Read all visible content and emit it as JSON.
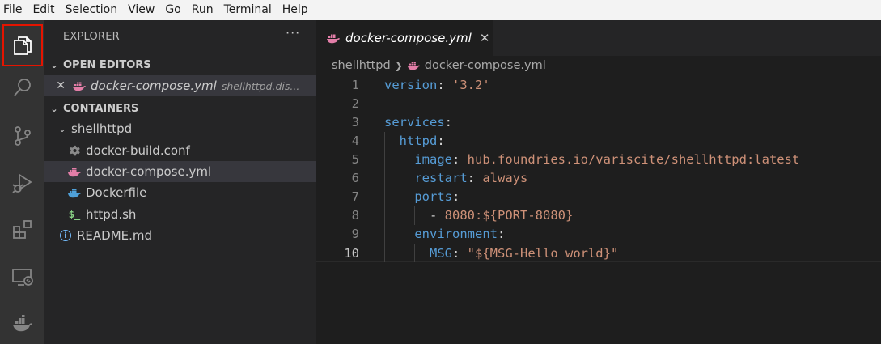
{
  "menu": [
    "File",
    "Edit",
    "Selection",
    "View",
    "Go",
    "Run",
    "Terminal",
    "Help"
  ],
  "activity_bar": [
    {
      "name": "explorer-icon",
      "active": true
    },
    {
      "name": "search-icon"
    },
    {
      "name": "source-control-icon"
    },
    {
      "name": "run-debug-icon"
    },
    {
      "name": "extensions-icon"
    },
    {
      "name": "remote-explorer-icon"
    },
    {
      "name": "docker-icon"
    }
  ],
  "sidebar": {
    "title": "EXPLORER",
    "more": "···",
    "open_editors": {
      "header": "OPEN EDITORS",
      "items": [
        {
          "close": "✕",
          "name": "docker-compose.yml",
          "path": "shellhttpd.dis..."
        }
      ]
    },
    "containers": {
      "header": "CONTAINERS",
      "folder": "shellhttpd",
      "files": [
        {
          "name": "docker-build.conf",
          "icon": "gear-icon"
        },
        {
          "name": "docker-compose.yml",
          "icon": "docker-file-icon"
        },
        {
          "name": "Dockerfile",
          "icon": "docker-file-icon"
        },
        {
          "name": "httpd.sh",
          "icon": "shell-icon",
          "icon_text": "$_"
        }
      ],
      "readme": {
        "name": "README.md",
        "icon": "info-icon",
        "icon_text": "i"
      }
    }
  },
  "editor": {
    "tab": {
      "name": "docker-compose.yml",
      "close": "✕"
    },
    "breadcrumb": [
      "shellhttpd",
      "docker-compose.yml"
    ],
    "current_line": 10,
    "lines": [
      {
        "n": "1",
        "tokens": [
          {
            "t": "version",
            "c": "k"
          },
          {
            "t": ": ",
            "c": "p"
          },
          {
            "t": "'3.2'",
            "c": "s"
          }
        ]
      },
      {
        "n": "2",
        "tokens": []
      },
      {
        "n": "3",
        "tokens": [
          {
            "t": "services",
            "c": "k"
          },
          {
            "t": ":",
            "c": "p"
          }
        ]
      },
      {
        "n": "4",
        "tokens": [
          {
            "t": "  ",
            "c": "p"
          },
          {
            "t": "httpd",
            "c": "k"
          },
          {
            "t": ":",
            "c": "p"
          }
        ]
      },
      {
        "n": "5",
        "tokens": [
          {
            "t": "    ",
            "c": "p"
          },
          {
            "t": "image",
            "c": "k"
          },
          {
            "t": ": ",
            "c": "p"
          },
          {
            "t": "hub.foundries.io/variscite/shellhttpd:latest",
            "c": "s"
          }
        ]
      },
      {
        "n": "6",
        "tokens": [
          {
            "t": "    ",
            "c": "p"
          },
          {
            "t": "restart",
            "c": "k"
          },
          {
            "t": ": ",
            "c": "p"
          },
          {
            "t": "always",
            "c": "s"
          }
        ]
      },
      {
        "n": "7",
        "tokens": [
          {
            "t": "    ",
            "c": "p"
          },
          {
            "t": "ports",
            "c": "k"
          },
          {
            "t": ":",
            "c": "p"
          }
        ]
      },
      {
        "n": "8",
        "tokens": [
          {
            "t": "      ",
            "c": "p"
          },
          {
            "t": "- ",
            "c": "p"
          },
          {
            "t": "8080:${PORT-8080}",
            "c": "s"
          }
        ]
      },
      {
        "n": "9",
        "tokens": [
          {
            "t": "    ",
            "c": "p"
          },
          {
            "t": "environment",
            "c": "k"
          },
          {
            "t": ":",
            "c": "p"
          }
        ]
      },
      {
        "n": "10",
        "tokens": [
          {
            "t": "      ",
            "c": "p"
          },
          {
            "t": "MSG",
            "c": "k"
          },
          {
            "t": ": ",
            "c": "p"
          },
          {
            "t": "\"${MSG-Hello world}\"",
            "c": "s"
          }
        ]
      }
    ]
  },
  "colors": {
    "accent_highlight": "#e51400",
    "docker_file_icon": "#e37ea8",
    "dockerfile_icon": "#4fa0d8",
    "shell_icon": "#89d185",
    "info_icon": "#75beff"
  }
}
